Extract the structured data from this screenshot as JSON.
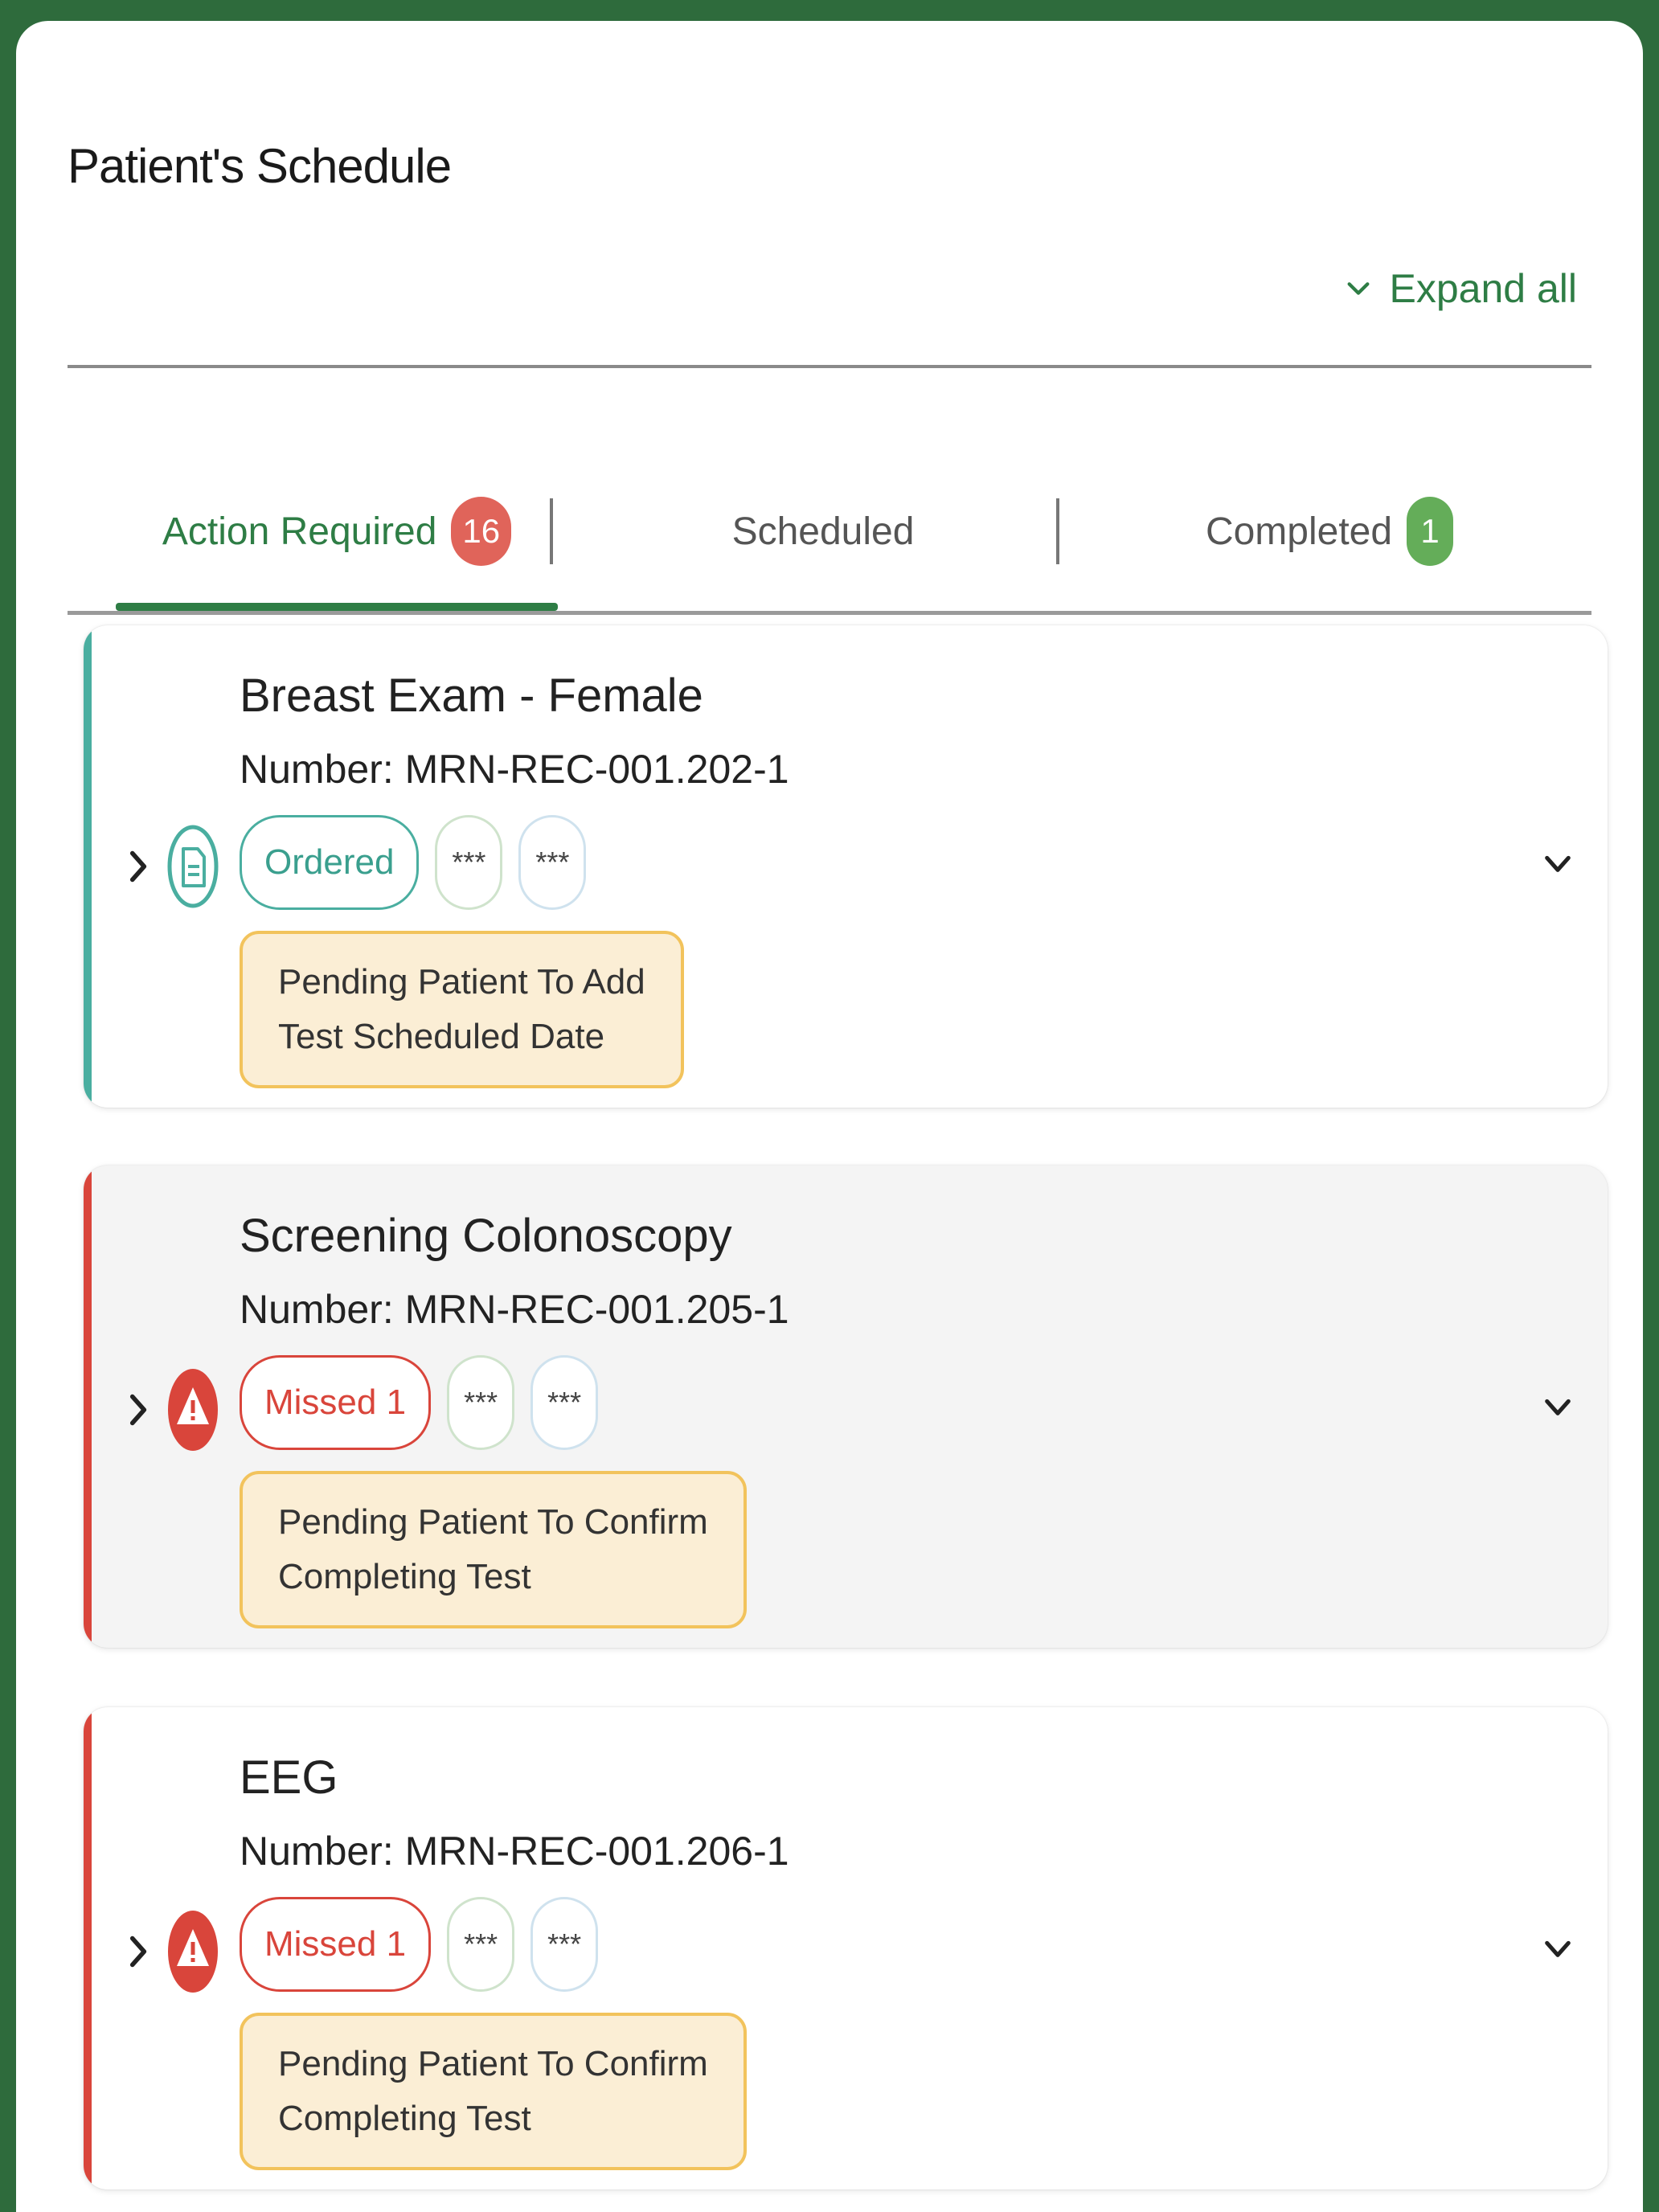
{
  "page": {
    "title": "Patient's Schedule",
    "expand_all_label": "Expand all"
  },
  "tabs": [
    {
      "label": "Action Required",
      "badge": "16",
      "active": true,
      "badge_color": "#e0645a"
    },
    {
      "label": "Scheduled",
      "badge": "",
      "active": false
    },
    {
      "label": "Completed",
      "badge": "1",
      "active": false,
      "badge_color": "#64ad59"
    }
  ],
  "cards": [
    {
      "title": "Breast Exam - Female",
      "number": "Number: MRN-REC-001.202-1",
      "status_label": "Ordered",
      "status_kind": "ordered",
      "status_icon": "document-icon",
      "accent_color": "#4aaea0",
      "chip_2": "***",
      "chip_3": "***",
      "pending": "Pending Patient To Add\nTest Scheduled Date"
    },
    {
      "title": "Screening Colonoscopy",
      "number": "Number: MRN-REC-001.205-1",
      "status_label": "Missed 1",
      "status_kind": "missed",
      "status_icon": "warning-icon",
      "accent_color": "#d9453b",
      "chip_2": "***",
      "chip_3": "***",
      "pending": "Pending Patient To Confirm\nCompleting Test"
    },
    {
      "title": "EEG",
      "number": "Number: MRN-REC-001.206-1",
      "status_label": "Missed 1",
      "status_kind": "missed",
      "status_icon": "warning-icon",
      "accent_color": "#d9453b",
      "chip_2": "***",
      "chip_3": "***",
      "pending": "Pending Patient To Confirm\nCompleting Test"
    }
  ],
  "colors": {
    "brand_green": "#2e7d45",
    "background": "#2e6b3c",
    "pending_bg": "#fbeed5",
    "pending_border": "#f2c35c"
  }
}
